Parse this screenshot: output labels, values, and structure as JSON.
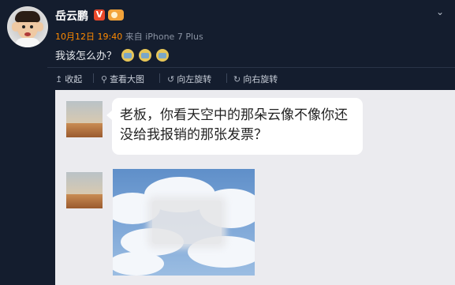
{
  "post": {
    "username": "岳云鹏",
    "verified_badge": "V",
    "timestamp": "10月12日 19:40",
    "source": "来自 iPhone 7 Plus",
    "text": "我该怎么办？",
    "emoji_count": 3
  },
  "actions": {
    "collapse": "收起",
    "view_large": "查看大图",
    "rotate_left": "向左旋转",
    "rotate_right": "向右旋转"
  },
  "chat": {
    "message": "老板，你看天空中的那朵云像不像你还没给我报销的那张发票？"
  },
  "colors": {
    "page_bg": "#141d2e",
    "accent_orange": "#ff8a00",
    "card_bg": "#ebebef"
  }
}
